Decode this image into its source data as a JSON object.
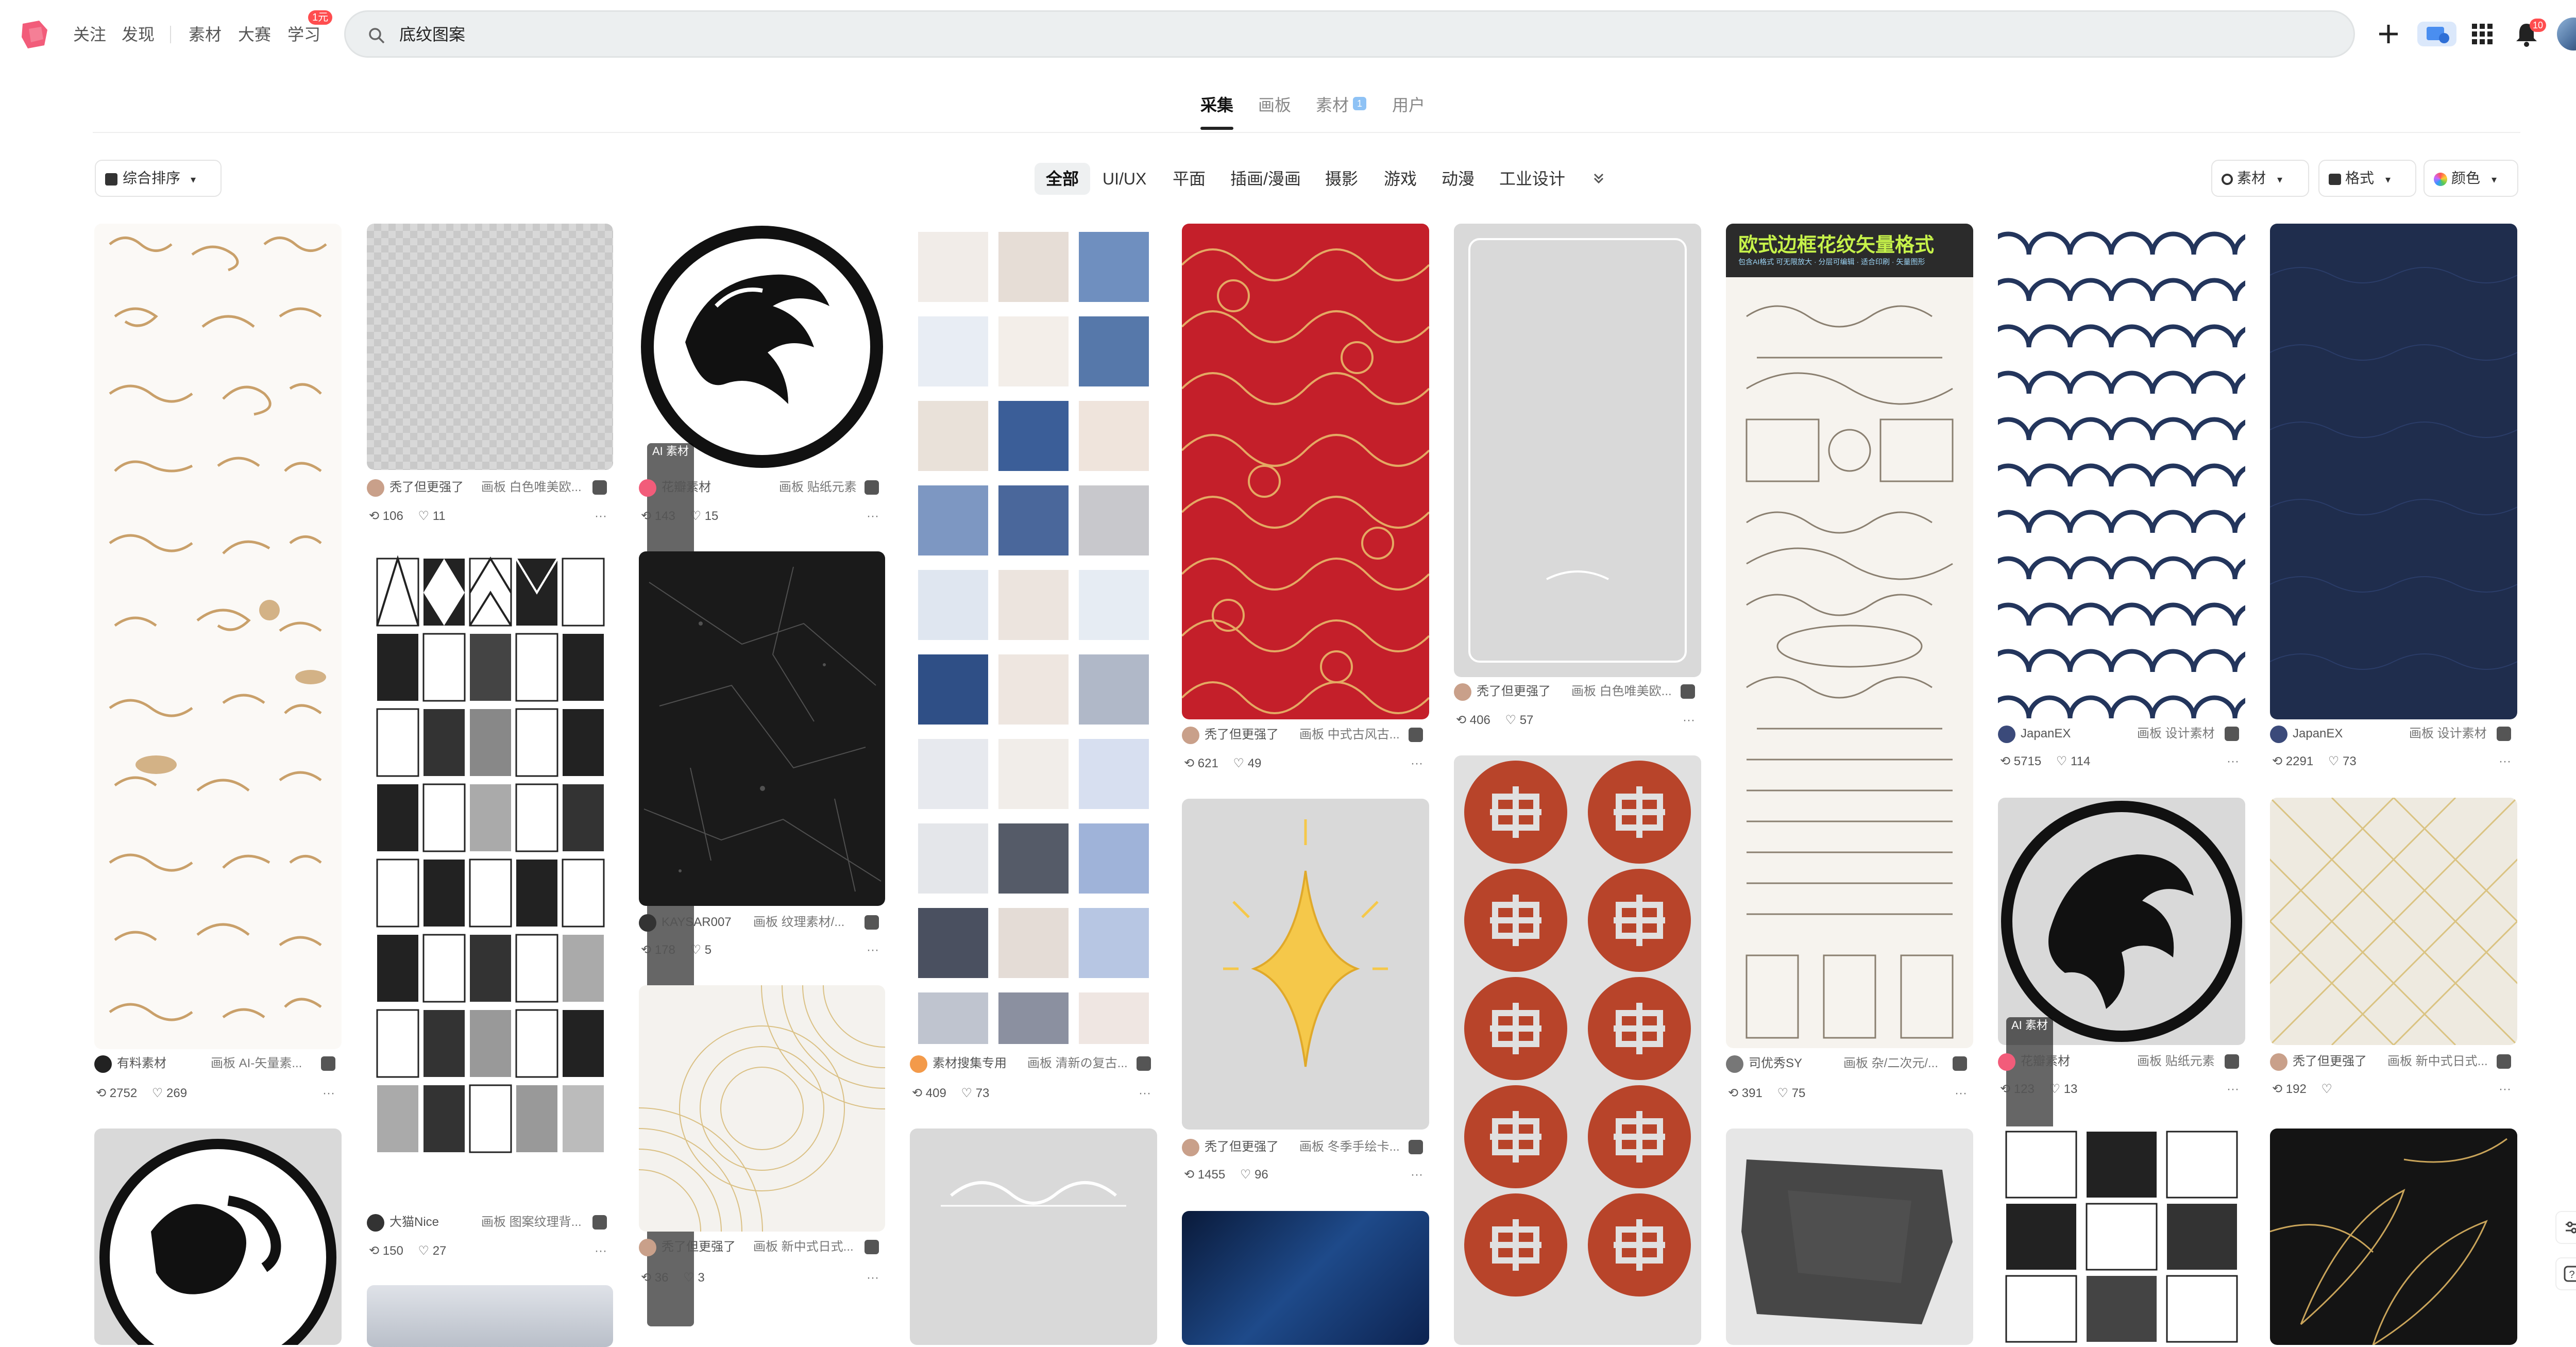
{
  "topnav": {
    "follow": "关注",
    "discover": "发现",
    "materials": "素材",
    "contest": "大赛",
    "learn": "学习",
    "learn_badge": "1元"
  },
  "search": {
    "query": "底纹图案"
  },
  "notif_badge": "10",
  "tabs": [
    {
      "label": "采集",
      "active": true
    },
    {
      "label": "画板"
    },
    {
      "label": "素材",
      "badge": "1"
    },
    {
      "label": "用户"
    }
  ],
  "filters": {
    "sort": "综合排序",
    "categories": [
      {
        "label": "全部",
        "active": true
      },
      {
        "label": "UI/UX"
      },
      {
        "label": "平面"
      },
      {
        "label": "插画/漫画"
      },
      {
        "label": "摄影"
      },
      {
        "label": "游戏"
      },
      {
        "label": "动漫"
      },
      {
        "label": "工业设计"
      }
    ],
    "material": "素材",
    "format": "格式",
    "color": "颜色"
  },
  "cards": [
    {
      "user": "有料素材",
      "board": "画板 AI-矢量素...",
      "repins": "2752",
      "likes": "269"
    },
    {
      "user": "秃了但更强了",
      "board": "画板 白色唯美欧...",
      "repins": "106",
      "likes": "11"
    },
    {
      "user": "大猫Nice",
      "board": "画板 图案纹理背...",
      "repins": "150",
      "likes": "27"
    },
    {
      "user": "花瓣素材",
      "board": "画板 贴纸元素",
      "repins": "143",
      "likes": "15",
      "ai": "AI 素材"
    },
    {
      "user": "KAYSAR007",
      "board": "画板 纹理素材/...",
      "repins": "178",
      "likes": "5"
    },
    {
      "user": "秃了但更强了",
      "board": "画板 新中式日式...",
      "repins": "36",
      "likes": "3"
    },
    {
      "user": "素材搜集专用",
      "board": "画板 清新の复古...",
      "repins": "409",
      "likes": "73"
    },
    {
      "user": "秃了但更强了",
      "board": "画板 中式古风古...",
      "repins": "621",
      "likes": "49"
    },
    {
      "user": "秃了但更强了",
      "board": "画板 冬季手绘卡...",
      "repins": "1455",
      "likes": "96"
    },
    {
      "user": "秃了但更强了",
      "board": "画板 白色唯美欧...",
      "repins": "406",
      "likes": "57"
    },
    {
      "user": "司优秀SY",
      "board": "画板 杂/二次元/...",
      "repins": "391",
      "likes": "75",
      "banner": "欧式边框花纹矢量格式",
      "banner_sub": "包含AI格式 可无限放大 · 分层可编辑 · 适合印刷 · 矢量图形"
    },
    {
      "user": "JapanEX",
      "board": "画板 设计素材",
      "repins": "5715",
      "likes": "114"
    },
    {
      "user": "花瓣素材",
      "board": "画板 贴纸元素",
      "repins": "123",
      "likes": "13",
      "ai": "AI 素材"
    },
    {
      "user": "JapanEX",
      "board": "画板 设计素材",
      "repins": "2291",
      "likes": "73"
    },
    {
      "user": "秃了但更强了",
      "board": "画板 新中式日式...",
      "repins": "192",
      "likes": ""
    }
  ],
  "colors": {
    "accent": "#ff4d4f",
    "brand": "#f25c7a"
  }
}
